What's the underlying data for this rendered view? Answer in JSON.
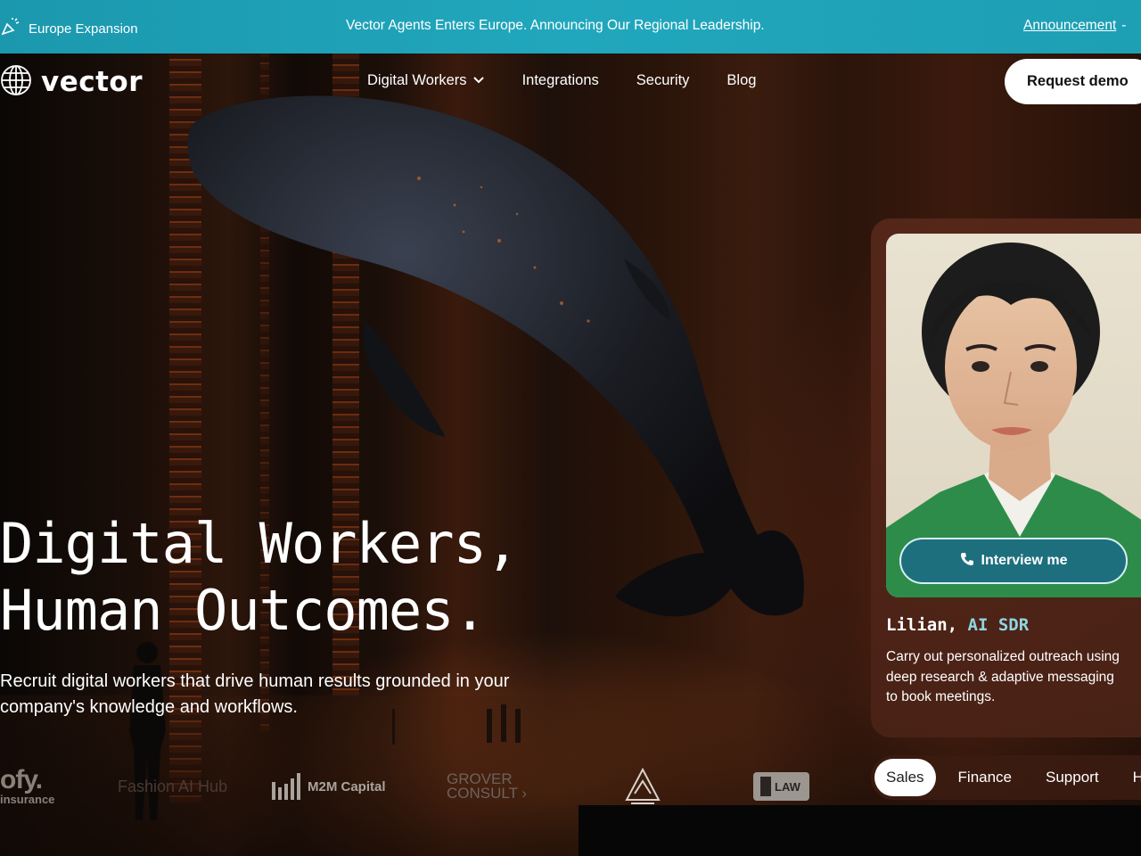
{
  "announcement": {
    "tag": "Europe Expansion",
    "headline": "Vector Agents Enters Europe. Announcing Our Regional Leadership.",
    "link": "Announcement",
    "icon": "megaphone-icon"
  },
  "brand": {
    "name": "vector",
    "icon": "globe-icon"
  },
  "nav": {
    "items": [
      {
        "label": "Digital Workers",
        "icon": "chevron-down-icon"
      },
      {
        "label": "Integrations"
      },
      {
        "label": "Security"
      },
      {
        "label": "Blog"
      }
    ],
    "cta": "Request demo"
  },
  "hero": {
    "headline_line1": "Digital Workers,",
    "headline_line2": "Human Outcomes.",
    "subline": "Recruit digital workers that drive human results grounded in your company's knowledge and workflows."
  },
  "logos": [
    {
      "name": "Defy insurance"
    },
    {
      "name": "Fashion AI Hub"
    },
    {
      "name": "M2M Capital"
    },
    {
      "name": "GROVER CONSULT"
    },
    {
      "name": "mountain-emblem"
    },
    {
      "name": "LAW"
    }
  ],
  "worker_card": {
    "cta": "Interview me",
    "name": "Lilian,",
    "role": "AI SDR",
    "description": "Carry out personalized outreach using deep research & adaptive messaging to book meetings.",
    "cta_icon": "phone-icon"
  },
  "tabs": {
    "items": [
      "Sales",
      "Finance",
      "Support",
      "HR"
    ],
    "active": "Sales"
  },
  "colors": {
    "announcement_bg": "#21a7bd",
    "accent_teal": "#1d6f7e",
    "role_color": "#8fd5e2"
  }
}
